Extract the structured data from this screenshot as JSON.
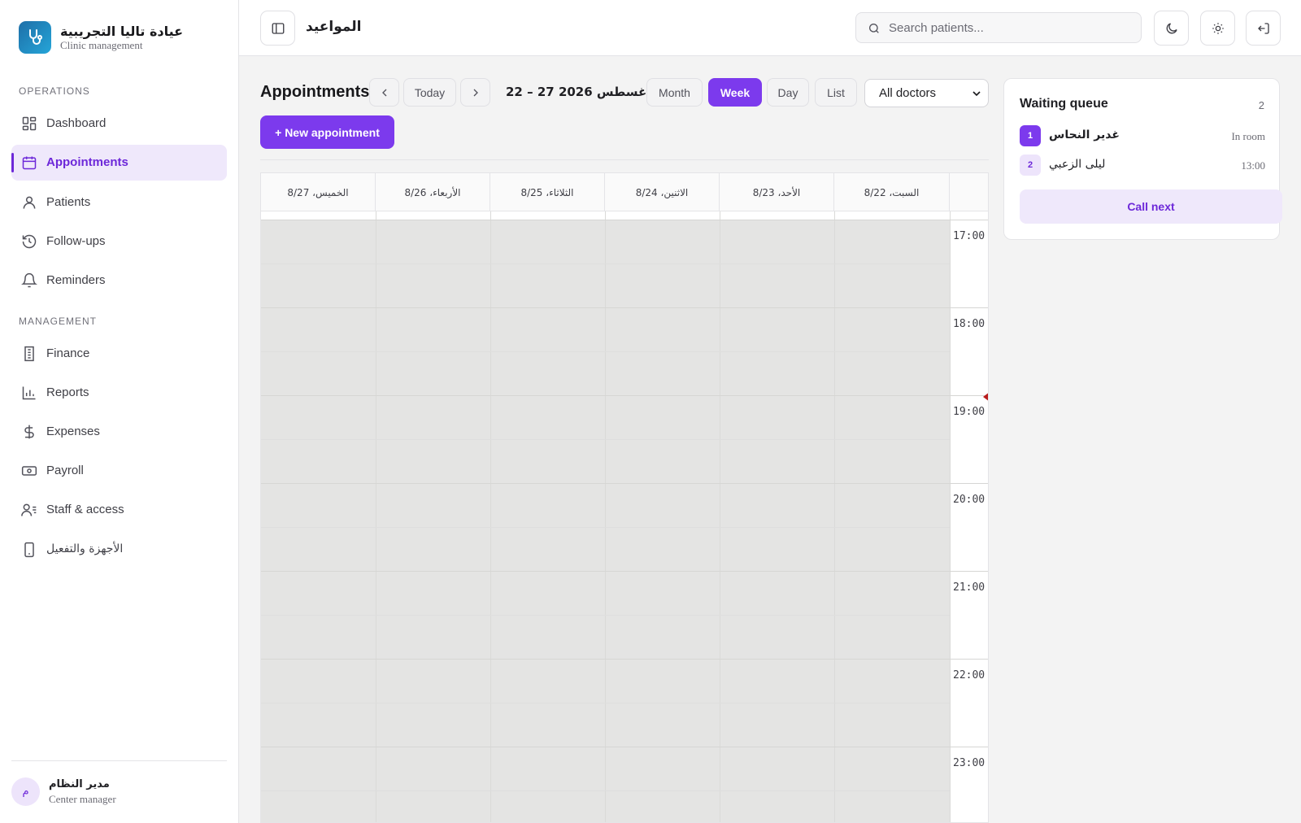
{
  "brand": {
    "name": "عيادة تاليا التجريبية",
    "subtitle": "Clinic management"
  },
  "sidebar": {
    "sections": {
      "operations": "OPERATIONS",
      "management": "MANAGEMENT"
    },
    "items": [
      {
        "label": "Dashboard",
        "icon": "dashboard-icon"
      },
      {
        "label": "Appointments",
        "icon": "calendar-icon",
        "active": true
      },
      {
        "label": "Patients",
        "icon": "user-icon"
      },
      {
        "label": "Follow-ups",
        "icon": "history-icon"
      },
      {
        "label": "Reminders",
        "icon": "bell-icon"
      },
      {
        "label": "Finance",
        "icon": "receipt-icon"
      },
      {
        "label": "Reports",
        "icon": "bar-chart-icon"
      },
      {
        "label": "Expenses",
        "icon": "dollar-icon"
      },
      {
        "label": "Payroll",
        "icon": "banknote-icon"
      },
      {
        "label": "Staff & access",
        "icon": "users-icon"
      },
      {
        "label": "الأجهزة والتفعيل",
        "icon": "smartphone-icon"
      }
    ]
  },
  "user": {
    "initial": "م",
    "name": "مدير النظام",
    "role": "Center manager"
  },
  "header": {
    "title": "المواعيد",
    "search_placeholder": "Search patients..."
  },
  "toolbar": {
    "title": "Appointments",
    "today": "Today",
    "range": "أغسطس 2026 27 – 22",
    "views": [
      "Month",
      "Week",
      "Day",
      "List"
    ],
    "active_view": "Week",
    "doctor_filter": "All doctors",
    "new_button": "+ New appointment"
  },
  "calendar": {
    "days": [
      "الخميس، 8/27",
      "الأربعاء، 8/26",
      "الثلاثاء، 8/25",
      "الاثنين، 8/24",
      "الأحد، 8/23",
      "السبت، 8/22"
    ],
    "hours": [
      "17:00",
      "18:00",
      "19:00",
      "20:00",
      "21:00",
      "22:00",
      "23:00"
    ]
  },
  "queue": {
    "title": "Waiting queue",
    "count": "2",
    "entries": [
      {
        "num": "1",
        "name": "غدير النحاس",
        "status": "In room"
      },
      {
        "num": "2",
        "name": "ليلى الزعبي",
        "status": "13:00"
      }
    ],
    "call_next": "Call next"
  },
  "colors": {
    "accent": "#7c3aed",
    "accent_light": "#efe8fb",
    "now_marker": "#b91c1c"
  }
}
